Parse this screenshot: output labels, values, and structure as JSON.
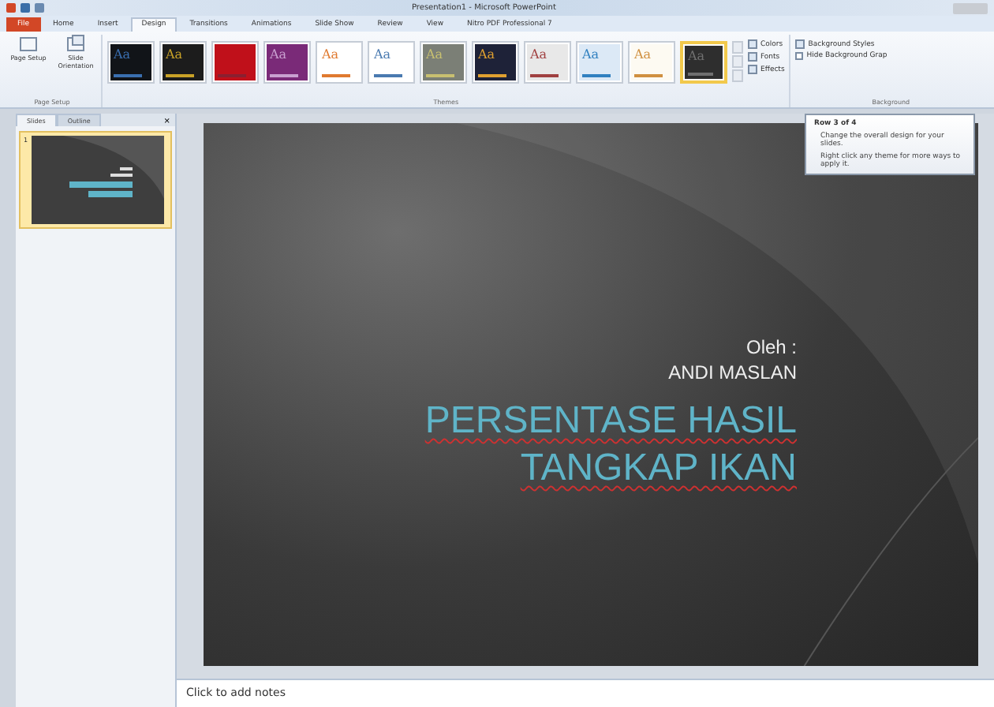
{
  "window": {
    "title": "Presentation1 - Microsoft PowerPoint"
  },
  "tabs": [
    {
      "label": "File",
      "selected": false,
      "kind": "file"
    },
    {
      "label": "Home",
      "selected": false,
      "kind": "tab"
    },
    {
      "label": "Insert",
      "selected": false,
      "kind": "tab"
    },
    {
      "label": "Design",
      "selected": true,
      "kind": "tab"
    },
    {
      "label": "Transitions",
      "selected": false,
      "kind": "tab"
    },
    {
      "label": "Animations",
      "selected": false,
      "kind": "tab"
    },
    {
      "label": "Slide Show",
      "selected": false,
      "kind": "tab"
    },
    {
      "label": "Review",
      "selected": false,
      "kind": "tab"
    },
    {
      "label": "View",
      "selected": false,
      "kind": "tab"
    },
    {
      "label": "Nitro PDF Professional 7",
      "selected": false,
      "kind": "tab"
    }
  ],
  "page_setup": {
    "buttons": [
      "Page Setup",
      "Slide Orientation"
    ],
    "group_label": "Page Setup"
  },
  "themes": {
    "group_label": "Themes",
    "items": [
      {
        "label": "Aa",
        "selected": false
      },
      {
        "label": "Aa",
        "selected": false
      },
      {
        "selected": false
      },
      {
        "label": "Aa",
        "selected": false
      },
      {
        "label": "Aa",
        "selected": false
      },
      {
        "label": "Aa",
        "selected": false
      },
      {
        "label": "Aa",
        "selected": false
      },
      {
        "label": "Aa",
        "selected": false
      },
      {
        "label": "Aa",
        "selected": false
      },
      {
        "label": "Aa",
        "selected": false
      },
      {
        "label": "Aa",
        "selected": false
      },
      {
        "label": "Aa",
        "selected": true
      }
    ]
  },
  "theme_options": [
    "Colors",
    "Fonts",
    "Effects"
  ],
  "background": {
    "styles": "Background Styles",
    "hide_graphics": "Hide Background Grap",
    "hide_checked": false,
    "group_label": "Background"
  },
  "tooltip": {
    "title": "Row 3 of 4",
    "lines": [
      "Change the overall design for your slides.",
      "Right click any theme for more ways to apply it."
    ]
  },
  "panel_tabs": [
    {
      "label": "Slides",
      "selected": true
    },
    {
      "label": "Outline",
      "selected": false
    }
  ],
  "panel_close": "×",
  "thumbnail": {
    "number": "1",
    "selected": true
  },
  "slide": {
    "byline": "Oleh :",
    "author": "ANDI MASLAN",
    "title_lines": [
      "PERSENTASE HASIL",
      "TANGKAP IKAN"
    ]
  },
  "notes": {
    "placeholder": "Click to add notes"
  }
}
